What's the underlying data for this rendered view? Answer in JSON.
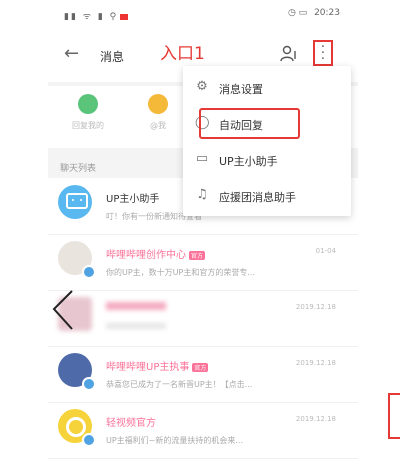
{
  "status_bar": {
    "time": "20:23",
    "battery_icon": "battery-icon",
    "signal_icon": "signal-icon"
  },
  "navbar": {
    "title": "消息",
    "annotation": "入口1"
  },
  "quick_actions": [
    {
      "label": "回复我的",
      "color": "#5bc47b"
    },
    {
      "label": "@我",
      "color": "#f5b93a"
    }
  ],
  "list_header": "聊天列表",
  "chats": [
    {
      "name": "UP主小助手",
      "msg": "叮！你有一份新通知待查看",
      "time": "",
      "pink": false,
      "tag": ""
    },
    {
      "name": "哔哩哔哩创作中心",
      "msg": "你的UP主，数十万UP主和官方的荣誉专...",
      "time": "01-04",
      "pink": true,
      "tag": "官方"
    },
    {
      "name": "",
      "msg": "",
      "time": "2019.12.18",
      "pink": true,
      "tag": ""
    },
    {
      "name": "哔哩哔哩UP主执事",
      "msg": "恭喜您已成为了一名新晋UP主！【点击...",
      "time": "2019.12.18",
      "pink": true,
      "tag": "官方"
    },
    {
      "name": "轻视频官方",
      "msg": "UP主福利们~新的流量扶持的机会来...",
      "time": "2019.12.18",
      "pink": true,
      "tag": ""
    }
  ],
  "dropdown_menu": [
    {
      "label": "消息设置",
      "icon": "gear-icon"
    },
    {
      "label": "自动回复",
      "icon": "chat-bubble-icon"
    },
    {
      "label": "UP主小助手",
      "icon": "tv-icon"
    },
    {
      "label": "应援团消息助手",
      "icon": "bell-icon"
    }
  ]
}
